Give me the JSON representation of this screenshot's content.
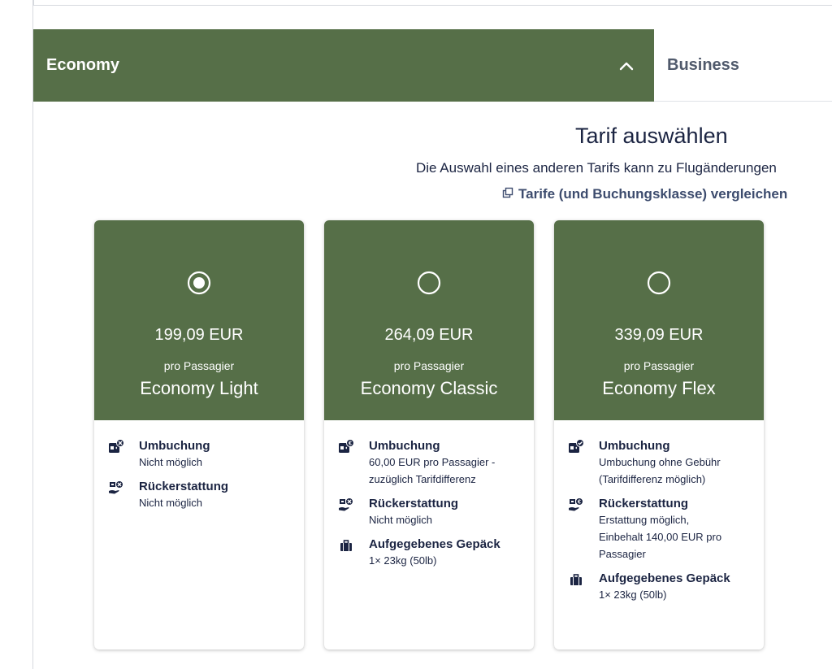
{
  "tabs": {
    "economy": "Economy",
    "business": "Business"
  },
  "header": {
    "title": "Tarif auswählen",
    "subtitle": "Die Auswahl eines anderen Tarifs kann zu Flugänderungen",
    "compare_link": "Tarife (und Buchungsklasse) vergleichen"
  },
  "colors": {
    "green": "#566f48",
    "navy": "#1b2442"
  },
  "cards": [
    {
      "selected": true,
      "price": "199,09 EUR",
      "per": "pro Passagier",
      "name": "Economy Light",
      "features": [
        {
          "icon": "rebooking-x-icon",
          "title": "Umbuchung",
          "desc": [
            "Nicht möglich"
          ]
        },
        {
          "icon": "refund-x-icon",
          "title": "Rückerstattung",
          "desc": [
            "Nicht möglich"
          ]
        }
      ]
    },
    {
      "selected": false,
      "price": "264,09 EUR",
      "per": "pro Passagier",
      "name": "Economy Classic",
      "features": [
        {
          "icon": "rebooking-euro-icon",
          "title": "Umbuchung",
          "desc": [
            "60,00 EUR pro Passagier -",
            "zuzüglich Tarifdifferenz"
          ]
        },
        {
          "icon": "refund-x-icon",
          "title": "Rückerstattung",
          "desc": [
            "Nicht möglich"
          ]
        },
        {
          "icon": "suitcase-icon",
          "title": "Aufgegebenes Gepäck",
          "desc": [
            "1× 23kg (50lb)"
          ]
        }
      ]
    },
    {
      "selected": false,
      "price": "339,09 EUR",
      "per": "pro Passagier",
      "name": "Economy Flex",
      "features": [
        {
          "icon": "rebooking-check-icon",
          "title": "Umbuchung",
          "desc": [
            "Umbuchung ohne Gebühr",
            "(Tarifdifferenz möglich)"
          ]
        },
        {
          "icon": "refund-euro-icon",
          "title": "Rückerstattung",
          "desc": [
            "Erstattung möglich,",
            "Einbehalt 140,00 EUR pro",
            "Passagier"
          ]
        },
        {
          "icon": "suitcase-icon",
          "title": "Aufgegebenes Gepäck",
          "desc": [
            "1× 23kg (50lb)"
          ]
        }
      ]
    }
  ]
}
